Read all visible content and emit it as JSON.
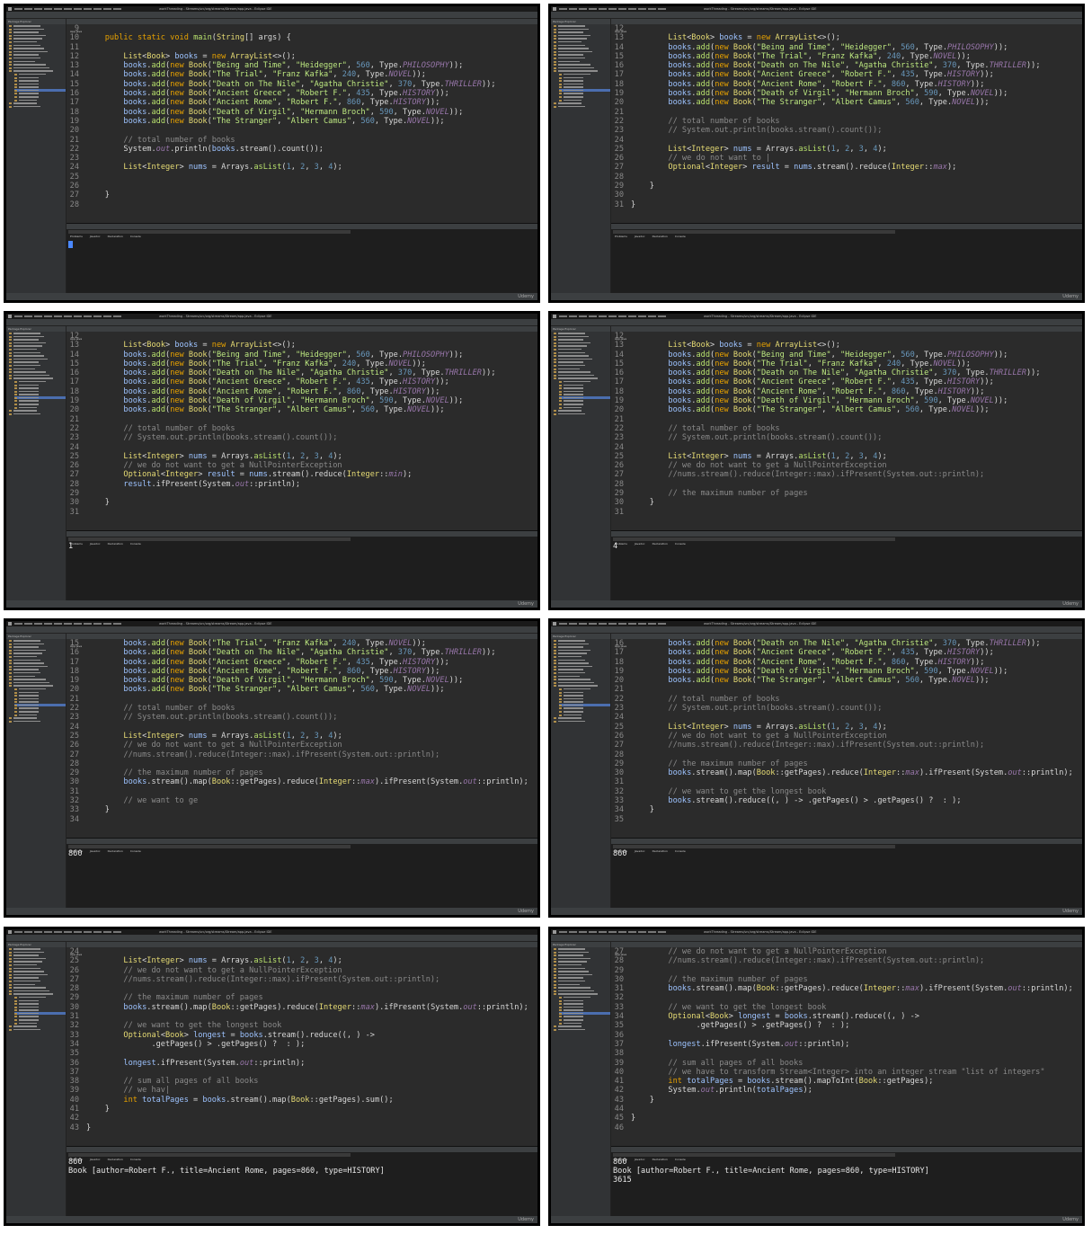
{
  "app": {
    "window_title": "workThreading - Streams/src/org/streams/Stream/app.java - Eclipse IDE",
    "editor_tab": "App.java",
    "explorer_title": "Package Explorer",
    "console_tabs": [
      "Problems",
      "Javadoc",
      "Declaration",
      "Console"
    ],
    "watermark": "Udemy"
  },
  "panels": [
    {
      "code": [
        {
          "n": "9",
          "t": ""
        },
        {
          "n": "10",
          "t": "    public static void main(String[] args) {"
        },
        {
          "n": "11",
          "t": ""
        },
        {
          "n": "12",
          "t": "        List<Book> books = new ArrayList<>();"
        },
        {
          "n": "13",
          "t": "        books.add(new Book(\"Being and Time\", \"Heidegger\", 560, Type.PHILOSOPHY));"
        },
        {
          "n": "14",
          "t": "        books.add(new Book(\"The Trial\", \"Franz Kafka\", 240, Type.NOVEL));"
        },
        {
          "n": "15",
          "t": "        books.add(new Book(\"Death on The Nile\", \"Agatha Christie\", 370, Type.THRILLER));"
        },
        {
          "n": "16",
          "t": "        books.add(new Book(\"Ancient Greece\", \"Robert F.\", 435, Type.HISTORY));"
        },
        {
          "n": "17",
          "t": "        books.add(new Book(\"Ancient Rome\", \"Robert F.\", 860, Type.HISTORY));"
        },
        {
          "n": "18",
          "t": "        books.add(new Book(\"Death of Virgil\", \"Hermann Broch\", 590, Type.NOVEL));"
        },
        {
          "n": "19",
          "t": "        books.add(new Book(\"The Stranger\", \"Albert Camus\", 560, Type.NOVEL));"
        },
        {
          "n": "20",
          "t": ""
        },
        {
          "n": "21",
          "t": "        // total number of books"
        },
        {
          "n": "22",
          "t": "        System.out.println(books.stream().count());"
        },
        {
          "n": "23",
          "t": ""
        },
        {
          "n": "24",
          "t": "        List<Integer> nums = Arrays.asList(1, 2, 3, 4);"
        },
        {
          "n": "25",
          "t": ""
        },
        {
          "n": "26",
          "t": ""
        },
        {
          "n": "27",
          "t": "    }"
        },
        {
          "n": "28",
          "t": ""
        }
      ],
      "console": [],
      "caret": true
    },
    {
      "code": [
        {
          "n": "12",
          "t": ""
        },
        {
          "n": "13",
          "t": "        List<Book> books = new ArrayList<>();"
        },
        {
          "n": "14",
          "t": "        books.add(new Book(\"Being and Time\", \"Heidegger\", 560, Type.PHILOSOPHY));"
        },
        {
          "n": "15",
          "t": "        books.add(new Book(\"The Trial\", \"Franz Kafka\", 240, Type.NOVEL));"
        },
        {
          "n": "16",
          "t": "        books.add(new Book(\"Death on The Nile\", \"Agatha Christie\", 370, Type.THRILLER));"
        },
        {
          "n": "17",
          "t": "        books.add(new Book(\"Ancient Greece\", \"Robert F.\", 435, Type.HISTORY));"
        },
        {
          "n": "18",
          "t": "        books.add(new Book(\"Ancient Rome\", \"Robert F.\", 860, Type.HISTORY));"
        },
        {
          "n": "19",
          "t": "        books.add(new Book(\"Death of Virgil\", \"Hermann Broch\", 590, Type.NOVEL));"
        },
        {
          "n": "20",
          "t": "        books.add(new Book(\"The Stranger\", \"Albert Camus\", 560, Type.NOVEL));"
        },
        {
          "n": "21",
          "t": ""
        },
        {
          "n": "22",
          "t": "        // total number of books"
        },
        {
          "n": "23",
          "t": "        // System.out.println(books.stream().count());"
        },
        {
          "n": "24",
          "t": ""
        },
        {
          "n": "25",
          "t": "        List<Integer> nums = Arrays.asList(1, 2, 3, 4);"
        },
        {
          "n": "26",
          "t": "        // we do not want to |"
        },
        {
          "n": "27",
          "t": "        Optional<Integer> result = nums.stream().reduce(Integer::max);"
        },
        {
          "n": "28",
          "t": ""
        },
        {
          "n": "29",
          "t": "    }"
        },
        {
          "n": "30",
          "t": ""
        },
        {
          "n": "31",
          "t": "}"
        }
      ],
      "console": [],
      "caret": false
    },
    {
      "code": [
        {
          "n": "12",
          "t": ""
        },
        {
          "n": "13",
          "t": "        List<Book> books = new ArrayList<>();"
        },
        {
          "n": "14",
          "t": "        books.add(new Book(\"Being and Time\", \"Heidegger\", 560, Type.PHILOSOPHY));"
        },
        {
          "n": "15",
          "t": "        books.add(new Book(\"The Trial\", \"Franz Kafka\", 240, Type.NOVEL));"
        },
        {
          "n": "16",
          "t": "        books.add(new Book(\"Death on The Nile\", \"Agatha Christie\", 370, Type.THRILLER));"
        },
        {
          "n": "17",
          "t": "        books.add(new Book(\"Ancient Greece\", \"Robert F.\", 435, Type.HISTORY));"
        },
        {
          "n": "18",
          "t": "        books.add(new Book(\"Ancient Rome\", \"Robert F.\", 860, Type.HISTORY));"
        },
        {
          "n": "19",
          "t": "        books.add(new Book(\"Death of Virgil\", \"Hermann Broch\", 590, Type.NOVEL));"
        },
        {
          "n": "20",
          "t": "        books.add(new Book(\"The Stranger\", \"Albert Camus\", 560, Type.NOVEL));"
        },
        {
          "n": "21",
          "t": ""
        },
        {
          "n": "22",
          "t": "        // total number of books"
        },
        {
          "n": "23",
          "t": "        // System.out.println(books.stream().count());"
        },
        {
          "n": "24",
          "t": ""
        },
        {
          "n": "25",
          "t": "        List<Integer> nums = Arrays.asList(1, 2, 3, 4);"
        },
        {
          "n": "26",
          "t": "        // we do not want to get a NullPointerException"
        },
        {
          "n": "27",
          "t": "        Optional<Integer> result = nums.stream().reduce(Integer::min);"
        },
        {
          "n": "28",
          "t": "        result.ifPresent(System.out::println);"
        },
        {
          "n": "29",
          "t": ""
        },
        {
          "n": "30",
          "t": "    }"
        },
        {
          "n": "31",
          "t": ""
        }
      ],
      "console": [
        "1"
      ],
      "caret": false
    },
    {
      "code": [
        {
          "n": "12",
          "t": ""
        },
        {
          "n": "13",
          "t": "        List<Book> books = new ArrayList<>();"
        },
        {
          "n": "14",
          "t": "        books.add(new Book(\"Being and Time\", \"Heidegger\", 560, Type.PHILOSOPHY));"
        },
        {
          "n": "15",
          "t": "        books.add(new Book(\"The Trial\", \"Franz Kafka\", 240, Type.NOVEL));"
        },
        {
          "n": "16",
          "t": "        books.add(new Book(\"Death on The Nile\", \"Agatha Christie\", 370, Type.THRILLER));"
        },
        {
          "n": "17",
          "t": "        books.add(new Book(\"Ancient Greece\", \"Robert F.\", 435, Type.HISTORY));"
        },
        {
          "n": "18",
          "t": "        books.add(new Book(\"Ancient Rome\", \"Robert F.\", 860, Type.HISTORY));"
        },
        {
          "n": "19",
          "t": "        books.add(new Book(\"Death of Virgil\", \"Hermann Broch\", 590, Type.NOVEL));"
        },
        {
          "n": "20",
          "t": "        books.add(new Book(\"The Stranger\", \"Albert Camus\", 560, Type.NOVEL));"
        },
        {
          "n": "21",
          "t": ""
        },
        {
          "n": "22",
          "t": "        // total number of books"
        },
        {
          "n": "23",
          "t": "        // System.out.println(books.stream().count());"
        },
        {
          "n": "24",
          "t": ""
        },
        {
          "n": "25",
          "t": "        List<Integer> nums = Arrays.asList(1, 2, 3, 4);"
        },
        {
          "n": "26",
          "t": "        // we do not want to get a NullPointerException"
        },
        {
          "n": "27",
          "t": "        //nums.stream().reduce(Integer::max).ifPresent(System.out::println);"
        },
        {
          "n": "28",
          "t": ""
        },
        {
          "n": "29",
          "t": "        // the maximum number of pages"
        },
        {
          "n": "30",
          "t": "    }"
        },
        {
          "n": "31",
          "t": ""
        }
      ],
      "console": [
        "4"
      ],
      "caret": false
    },
    {
      "code": [
        {
          "n": "15",
          "t": "        books.add(new Book(\"The Trial\", \"Franz Kafka\", 240, Type.NOVEL));"
        },
        {
          "n": "16",
          "t": "        books.add(new Book(\"Death on The Nile\", \"Agatha Christie\", 370, Type.THRILLER));"
        },
        {
          "n": "17",
          "t": "        books.add(new Book(\"Ancient Greece\", \"Robert F.\", 435, Type.HISTORY));"
        },
        {
          "n": "18",
          "t": "        books.add(new Book(\"Ancient Rome\", \"Robert F.\", 860, Type.HISTORY));"
        },
        {
          "n": "19",
          "t": "        books.add(new Book(\"Death of Virgil\", \"Hermann Broch\", 590, Type.NOVEL));"
        },
        {
          "n": "20",
          "t": "        books.add(new Book(\"The Stranger\", \"Albert Camus\", 560, Type.NOVEL));"
        },
        {
          "n": "21",
          "t": ""
        },
        {
          "n": "22",
          "t": "        // total number of books"
        },
        {
          "n": "23",
          "t": "        // System.out.println(books.stream().count());"
        },
        {
          "n": "24",
          "t": ""
        },
        {
          "n": "25",
          "t": "        List<Integer> nums = Arrays.asList(1, 2, 3, 4);"
        },
        {
          "n": "26",
          "t": "        // we do not want to get a NullPointerException"
        },
        {
          "n": "27",
          "t": "        //nums.stream().reduce(Integer::max).ifPresent(System.out::println);"
        },
        {
          "n": "28",
          "t": ""
        },
        {
          "n": "29",
          "t": "        // the maximum number of pages"
        },
        {
          "n": "30",
          "t": "        books.stream().map(Book::getPages).reduce(Integer::max).ifPresent(System.out::println);"
        },
        {
          "n": "31",
          "t": ""
        },
        {
          "n": "32",
          "t": "        // we want to ge"
        },
        {
          "n": "33",
          "t": "    }"
        },
        {
          "n": "34",
          "t": ""
        }
      ],
      "console": [
        "860"
      ],
      "caret": false
    },
    {
      "code": [
        {
          "n": "16",
          "t": "        books.add(new Book(\"Death on The Nile\", \"Agatha Christie\", 370, Type.THRILLER));"
        },
        {
          "n": "17",
          "t": "        books.add(new Book(\"Ancient Greece\", \"Robert F.\", 435, Type.HISTORY));"
        },
        {
          "n": "18",
          "t": "        books.add(new Book(\"Ancient Rome\", \"Robert F.\", 860, Type.HISTORY));"
        },
        {
          "n": "19",
          "t": "        books.add(new Book(\"Death of Virgil\", \"Hermann Broch\", 590, Type.NOVEL));"
        },
        {
          "n": "20",
          "t": "        books.add(new Book(\"The Stranger\", \"Albert Camus\", 560, Type.NOVEL));"
        },
        {
          "n": "21",
          "t": ""
        },
        {
          "n": "22",
          "t": "        // total number of books"
        },
        {
          "n": "23",
          "t": "        // System.out.println(books.stream().count());"
        },
        {
          "n": "24",
          "t": ""
        },
        {
          "n": "25",
          "t": "        List<Integer> nums = Arrays.asList(1, 2, 3, 4);"
        },
        {
          "n": "26",
          "t": "        // we do not want to get a NullPointerException"
        },
        {
          "n": "27",
          "t": "        //nums.stream().reduce(Integer::max).ifPresent(System.out::println);"
        },
        {
          "n": "28",
          "t": ""
        },
        {
          "n": "29",
          "t": "        // the maximum number of pages"
        },
        {
          "n": "30",
          "t": "        books.stream().map(Book::getPages).reduce(Integer::max).ifPresent(System.out::println);"
        },
        {
          "n": "31",
          "t": ""
        },
        {
          "n": "32",
          "t": "        // we want to get the longest book"
        },
        {
          "n": "33",
          "t": "        books.stream().reduce((b1, b2) -> b1.getPages() > b2.getPages() ? b1 : b2);"
        },
        {
          "n": "34",
          "t": "    }"
        },
        {
          "n": "35",
          "t": ""
        }
      ],
      "console": [
        "860"
      ],
      "caret": false
    },
    {
      "code": [
        {
          "n": "24",
          "t": ""
        },
        {
          "n": "25",
          "t": "        List<Integer> nums = Arrays.asList(1, 2, 3, 4);"
        },
        {
          "n": "26",
          "t": "        // we do not want to get a NullPointerException"
        },
        {
          "n": "27",
          "t": "        //nums.stream().reduce(Integer::max).ifPresent(System.out::println);"
        },
        {
          "n": "28",
          "t": ""
        },
        {
          "n": "29",
          "t": "        // the maximum number of pages"
        },
        {
          "n": "30",
          "t": "        books.stream().map(Book::getPages).reduce(Integer::max).ifPresent(System.out::println);"
        },
        {
          "n": "31",
          "t": ""
        },
        {
          "n": "32",
          "t": "        // we want to get the longest book"
        },
        {
          "n": "33",
          "t": "        Optional<Book> longest = books.stream().reduce((b1, b2) ->"
        },
        {
          "n": "34",
          "t": "              b1.getPages() > b2.getPages() ? b1 : b2);"
        },
        {
          "n": "35",
          "t": ""
        },
        {
          "n": "36",
          "t": "        longest.ifPresent(System.out::println);"
        },
        {
          "n": "37",
          "t": ""
        },
        {
          "n": "38",
          "t": "        // sum all pages of all books"
        },
        {
          "n": "39",
          "t": "        // we hav|"
        },
        {
          "n": "40",
          "t": "        int totalPages = books.stream().map(Book::getPages).sum();"
        },
        {
          "n": "41",
          "t": "    }"
        },
        {
          "n": "42",
          "t": ""
        },
        {
          "n": "43",
          "t": "}"
        }
      ],
      "console": [
        "860",
        "Book [author=Robert F., title=Ancient Rome, pages=860, type=HISTORY]"
      ],
      "caret": false
    },
    {
      "code": [
        {
          "n": "27",
          "t": "        // we do not want to get a NullPointerException"
        },
        {
          "n": "28",
          "t": "        //nums.stream().reduce(Integer::max).ifPresent(System.out::println);"
        },
        {
          "n": "29",
          "t": ""
        },
        {
          "n": "30",
          "t": "        // the maximum number of pages"
        },
        {
          "n": "31",
          "t": "        books.stream().map(Book::getPages).reduce(Integer::max).ifPresent(System.out::println);"
        },
        {
          "n": "32",
          "t": ""
        },
        {
          "n": "33",
          "t": "        // we want to get the longest book"
        },
        {
          "n": "34",
          "t": "        Optional<Book> longest = books.stream().reduce((b1, b2) ->"
        },
        {
          "n": "35",
          "t": "              b1.getPages() > b2.getPages() ? b1 : b2);"
        },
        {
          "n": "36",
          "t": ""
        },
        {
          "n": "37",
          "t": "        longest.ifPresent(System.out::println);"
        },
        {
          "n": "38",
          "t": ""
        },
        {
          "n": "39",
          "t": "        // sum all pages of all books"
        },
        {
          "n": "40",
          "t": "        // we have to transform Stream<Integer> into an integer stream \"list of integers\""
        },
        {
          "n": "41",
          "t": "        int totalPages = books.stream().mapToInt(Book::getPages);"
        },
        {
          "n": "42",
          "t": "        System.out.println(totalPages);"
        },
        {
          "n": "43",
          "t": "    }"
        },
        {
          "n": "44",
          "t": ""
        },
        {
          "n": "45",
          "t": "}"
        },
        {
          "n": "46",
          "t": ""
        }
      ],
      "console": [
        "860",
        "Book [author=Robert F., title=Ancient Rome, pages=860, type=HISTORY]",
        "3615"
      ],
      "caret": false
    }
  ]
}
